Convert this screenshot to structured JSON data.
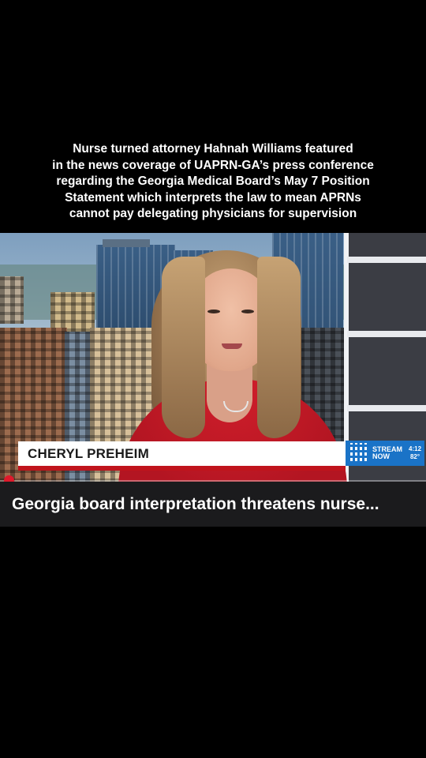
{
  "post": {
    "caption": "Nurse turned attorney Hahnah Williams featured\nin the news coverage of UAPRN-GA’s press conference\nregarding  the Georgia Medical Board’s  May 7 Position\nStatement which interprets the law to mean  APRNs\ncannot pay delegating physicians for supervision"
  },
  "video": {
    "lower_third_name": "CHERYL PREHEIM",
    "bug": {
      "stream_line1": "STREAM",
      "stream_line2": "NOW",
      "time": "4:12",
      "temperature": "82°"
    },
    "headline": "Georgia board interpretation threatens nurse...",
    "progress": 0.02
  },
  "colors": {
    "accent_red": "#c0141c",
    "bug_blue": "#1a73c7",
    "progress_dot": "#e0192b"
  }
}
